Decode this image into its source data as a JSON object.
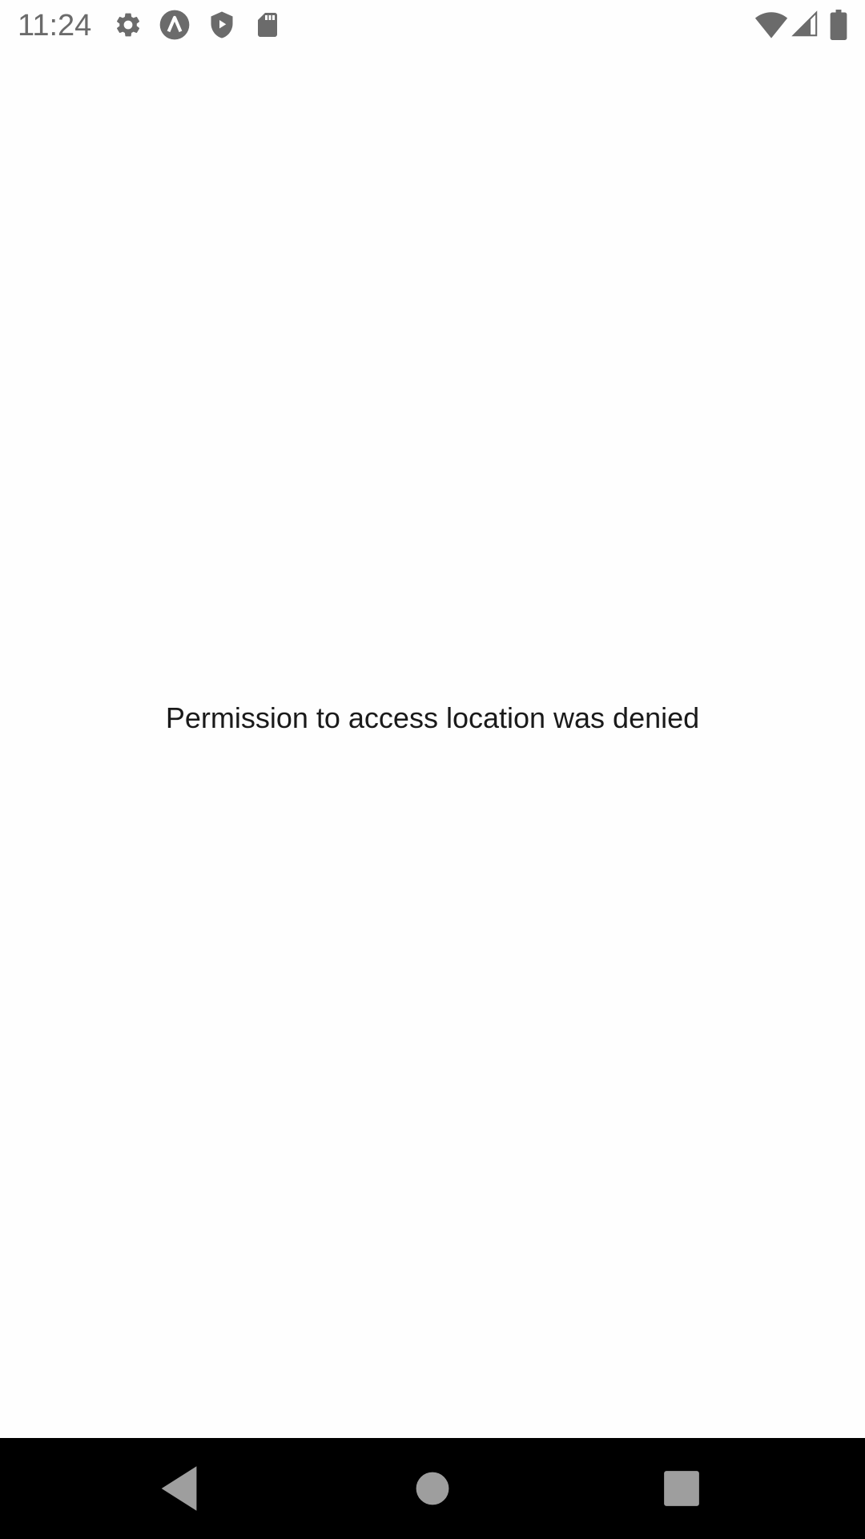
{
  "status_bar": {
    "time": "11:24",
    "left_icons": [
      "gear-icon",
      "launcher-icon",
      "shield-play-icon",
      "sd-card-icon"
    ],
    "right_icons": [
      "wifi-icon",
      "cell-signal-icon",
      "battery-icon"
    ]
  },
  "main": {
    "message": "Permission to access location was denied"
  },
  "nav_bar": {
    "buttons": [
      "back-button",
      "home-button",
      "recents-button"
    ]
  },
  "colors": {
    "background": "#fefefe",
    "status_icon": "#6b6b6b",
    "nav_background": "#000000",
    "nav_icon": "#9e9e9e"
  }
}
